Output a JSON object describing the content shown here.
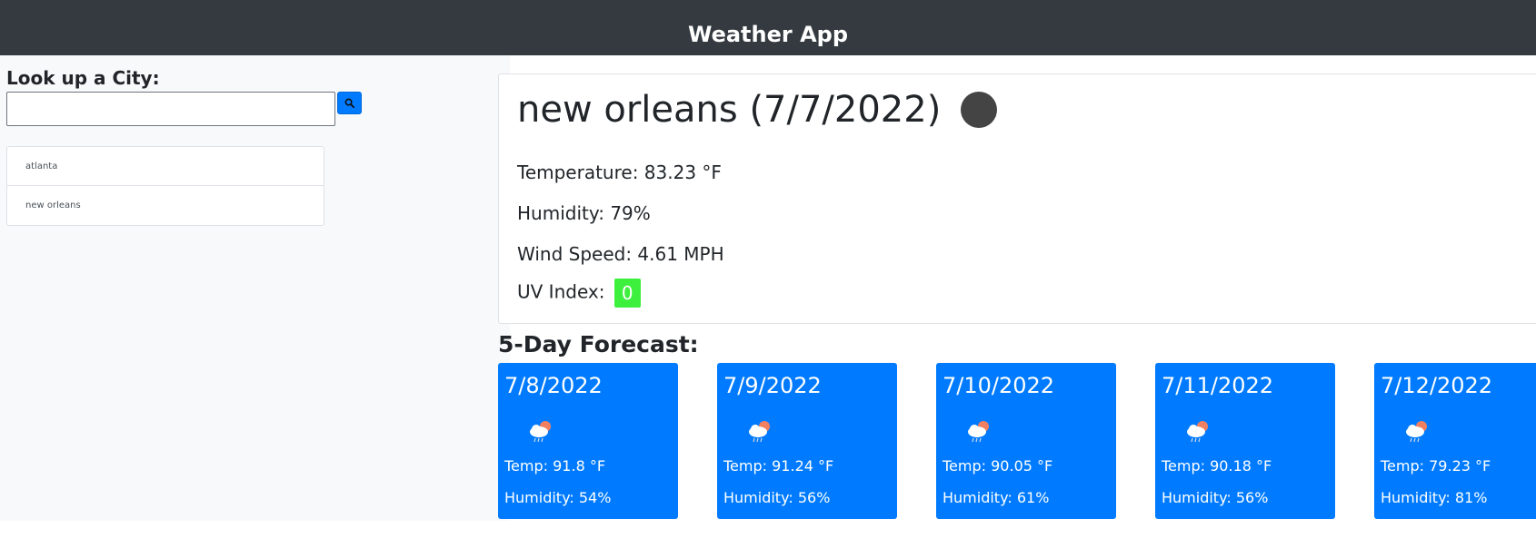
{
  "app": {
    "title": "Weather App"
  },
  "sidebar": {
    "lookup_label": "Look up a City:",
    "search_value": "",
    "history": [
      "atlanta",
      "new orleans"
    ]
  },
  "current": {
    "title": "new orleans (7/7/2022)",
    "temperature": "Temperature: 83.23 °F",
    "humidity": "Humidity: 79%",
    "wind": "Wind Speed: 4.61 MPH",
    "uv_label": "UV Index:",
    "uv_value": "0",
    "uv_color": "#3ef03e",
    "icon": "weather-icon"
  },
  "forecast": {
    "title": "5-Day Forecast:",
    "card_color": "#007bff",
    "icon": "cloud-rain-sun-icon",
    "days": [
      {
        "date": "7/8/2022",
        "temp": "Temp: 91.8 °F",
        "humidity": "Humidity: 54%"
      },
      {
        "date": "7/9/2022",
        "temp": "Temp: 91.24 °F",
        "humidity": "Humidity: 56%"
      },
      {
        "date": "7/10/2022",
        "temp": "Temp: 90.05 °F",
        "humidity": "Humidity: 61%"
      },
      {
        "date": "7/11/2022",
        "temp": "Temp: 90.18 °F",
        "humidity": "Humidity: 56%"
      },
      {
        "date": "7/12/2022",
        "temp": "Temp: 79.23 °F",
        "humidity": "Humidity: 81%"
      }
    ]
  }
}
